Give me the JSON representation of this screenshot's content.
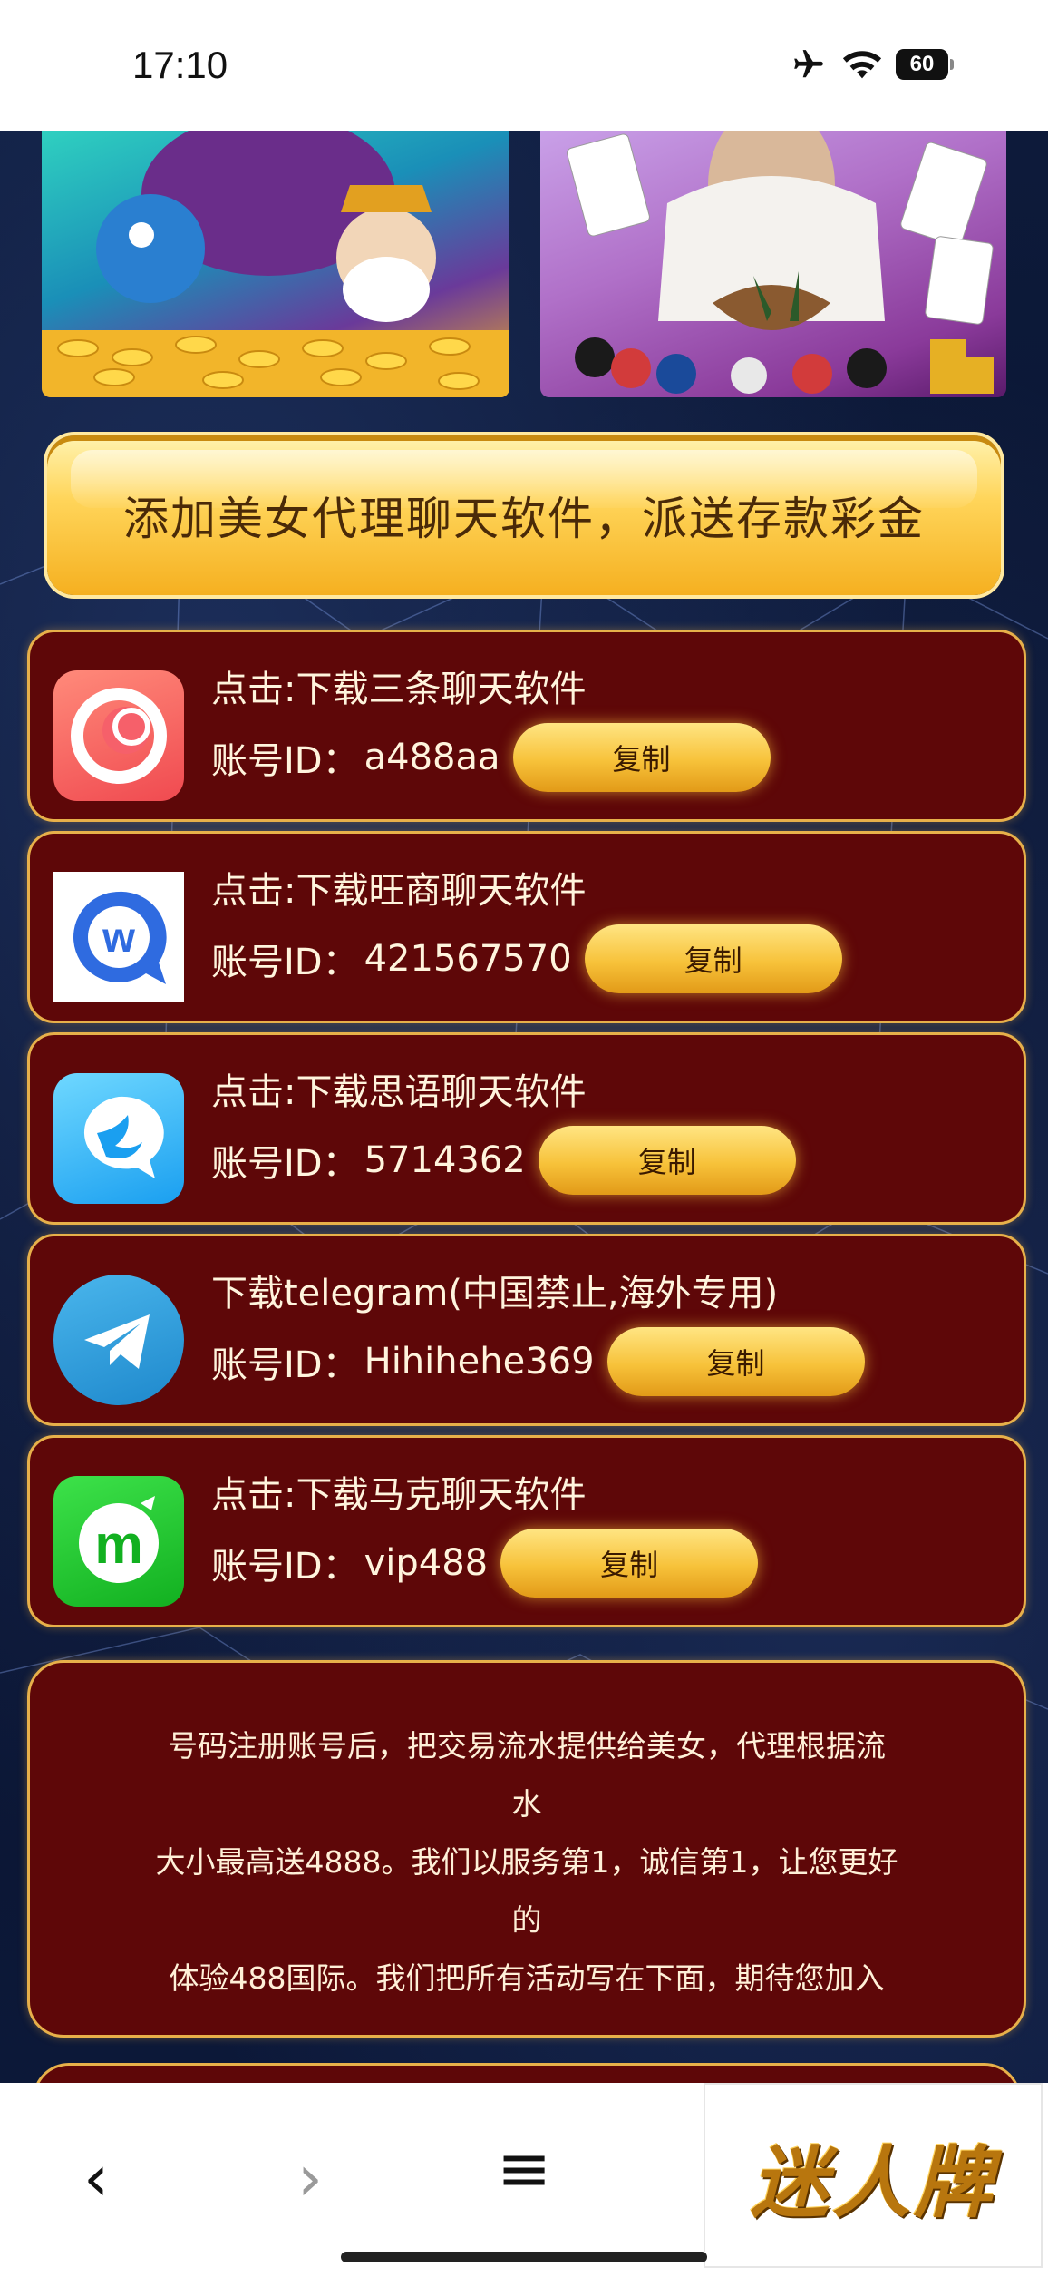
{
  "status_bar": {
    "time": "17:10",
    "battery": "60"
  },
  "promo": {
    "text": "添加美女代理聊天软件，派送存款彩金"
  },
  "apps": [
    {
      "title": "点击:下载三条聊天软件",
      "label": "账号ID：",
      "account": "a488aa",
      "copy": "复制"
    },
    {
      "title": "点击:下载旺商聊天软件",
      "label": "账号ID：",
      "account": "421567570",
      "copy": "复制"
    },
    {
      "title": "点击:下载思语聊天软件",
      "label": "账号ID：",
      "account": "5714362",
      "copy": "复制"
    },
    {
      "title": "下载telegram(中国禁止,海外专用)",
      "label": "账号ID：",
      "account": "Hihihehe369",
      "copy": "复制"
    },
    {
      "title": "点击:下载马克聊天软件",
      "label": "账号ID：",
      "account": "vip488",
      "copy": "复制"
    }
  ],
  "notice": {
    "line1": "号码注册账号后，把交易流水提供给美女，代理根据流",
    "line2": "水",
    "line3": "大小最高送4888。我们以服务第1，诚信第1，让您更好",
    "line4": "的",
    "line5": "体验488国际。我们把所有活动写在下面，期待您加入"
  },
  "nav": {
    "back": "‹",
    "forward": "›",
    "menu": "≡"
  },
  "brand": {
    "text": "迷人牌"
  }
}
